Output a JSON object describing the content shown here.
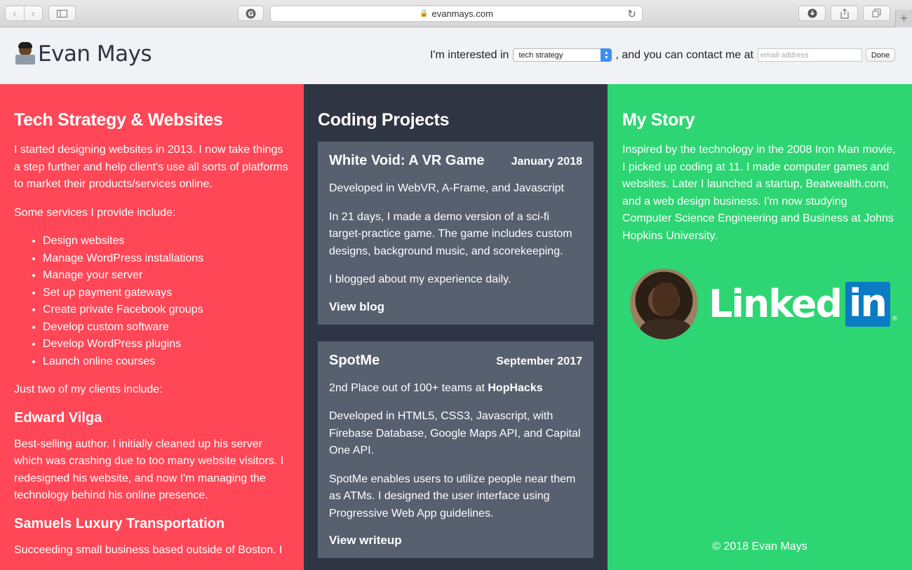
{
  "browser": {
    "url": "evanmays.com",
    "nav_back_icon": "chevron-left",
    "nav_forward_icon": "chevron-right"
  },
  "header": {
    "logo_text": "Evan Mays",
    "interest_prefix": "I'm interested in",
    "interest_selected": "tech strategy",
    "contact_text": ", and you can contact me at",
    "email_placeholder": "email address",
    "done_label": "Done"
  },
  "colors": {
    "red": "#ff4757",
    "dark": "#2f3542",
    "card": "#57606f",
    "green": "#2ed573"
  },
  "tech": {
    "title": "Tech Strategy & Websites",
    "intro": "I started designing websites in 2013. I now take things a step further and help client's use all sorts of platforms to market their products/services online.",
    "services_intro": "Some services I provide include:",
    "services": [
      "Design websites",
      "Manage WordPress installations",
      "Manage your server",
      "Set up payment gateways",
      "Create private Facebook groups",
      "Develop custom software",
      "Develop WordPress plugins",
      "Launch online courses"
    ],
    "clients_intro": "Just two of my clients include:",
    "clients": [
      {
        "name": "Edward Vilga",
        "desc": "Best-selling author. I initially cleaned up his server which was crashing due to too many website visitors. I redesigned his website, and now I'm managing the technology behind his online presence."
      },
      {
        "name": "Samuels Luxury Transportation",
        "desc": "Succeeding small business based outside of Boston. I"
      }
    ]
  },
  "projects": {
    "title": "Coding Projects",
    "items": [
      {
        "title": "White Void: A VR Game",
        "date": "January 2018",
        "p1": "Developed in WebVR, A-Frame, and Javascript",
        "p2": "In 21 days, I made a demo version of a sci-fi target-practice game. The game includes custom designs, background music, and scorekeeping.",
        "p3": "I blogged about my experience daily.",
        "link": "View blog"
      },
      {
        "title": "SpotMe",
        "date": "September 2017",
        "p1_prefix": "2nd Place out of 100+ teams at ",
        "p1_bold": "HopHacks",
        "p2": "Developed in HTML5, CSS3, Javascript, with Firebase Database, Google Maps API, and Capital One API.",
        "p3": "SpotMe enables users to utilize people near them as ATMs. I designed the user interface using Progressive Web App guidelines.",
        "link": "View writeup"
      }
    ]
  },
  "story": {
    "title": "My Story",
    "text": "Inspired by the technology in the 2008 Iron Man movie, I picked up coding at 11. I made computer games and websites. Later I launched a startup, Beatwealth.com, and a web design business. I'm now studying Computer Science Engineering and Business at Johns Hopkins University.",
    "linkedin_text": "Linked",
    "linkedin_in": "in",
    "linkedin_reg": "®",
    "footer": "© 2018 Evan Mays"
  }
}
